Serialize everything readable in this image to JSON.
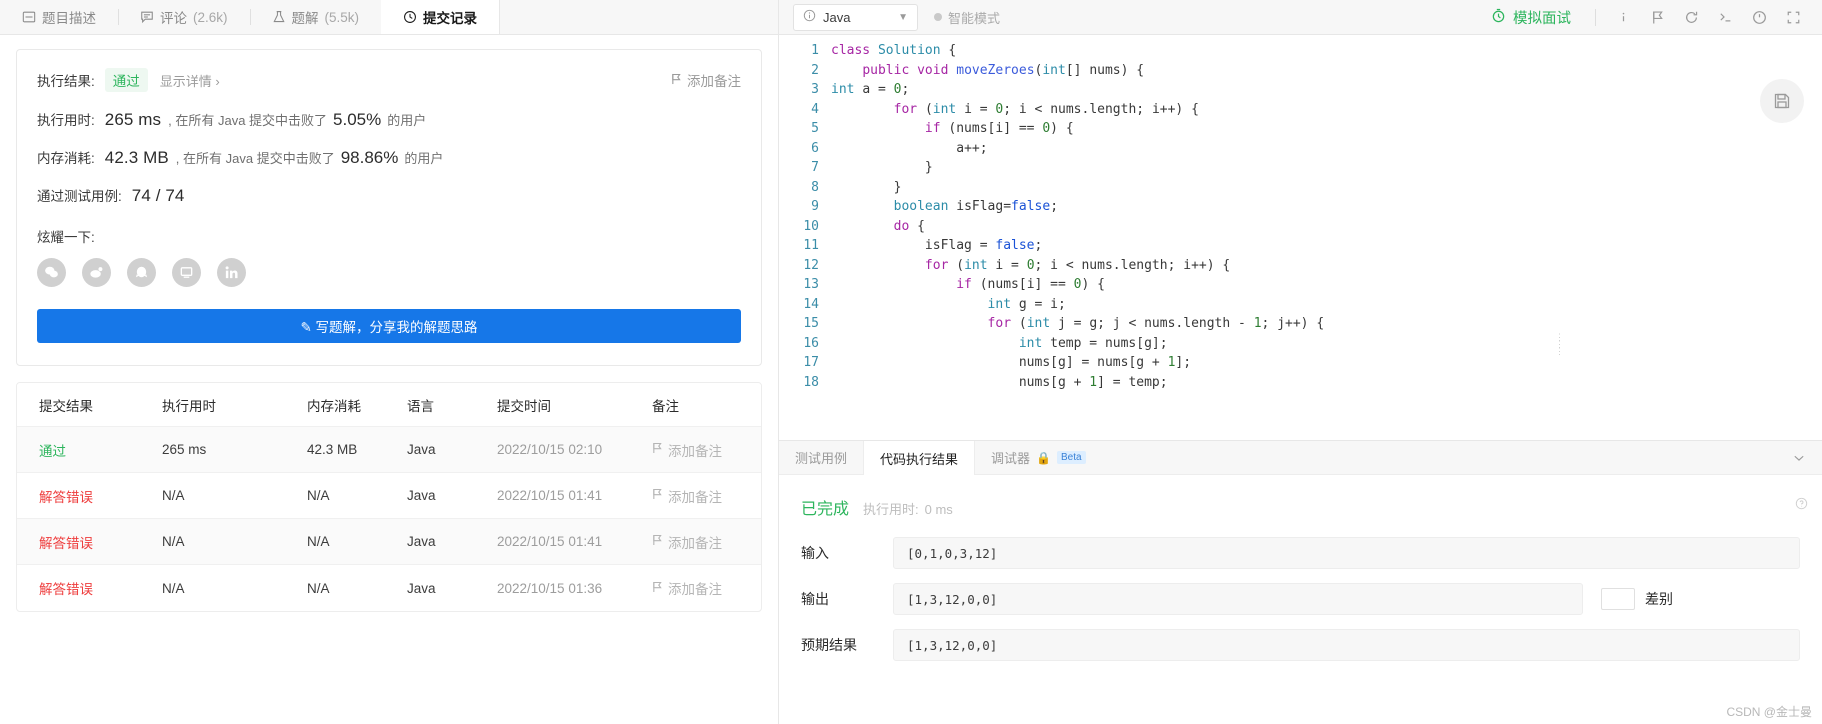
{
  "left_tabs": [
    {
      "label": "题目描述",
      "count": "",
      "icon": "description-icon",
      "active": false
    },
    {
      "label": "评论",
      "count": "(2.6k)",
      "icon": "comment-icon",
      "active": false
    },
    {
      "label": "题解",
      "count": "(5.5k)",
      "icon": "flask-icon",
      "active": false
    },
    {
      "label": "提交记录",
      "count": "",
      "icon": "clock-icon",
      "active": true
    }
  ],
  "result": {
    "exec_result_label": "执行结果:",
    "status": "通过",
    "detail_link": "显示详情 ›",
    "add_note": "添加备注",
    "runtime_label": "执行用时:",
    "runtime_value": "265 ms",
    "runtime_mid": ", 在所有 Java 提交中击败了",
    "runtime_pct": "5.05%",
    "runtime_suffix": "的用户",
    "memory_label": "内存消耗:",
    "memory_value": "42.3 MB",
    "memory_mid": ", 在所有 Java 提交中击败了",
    "memory_pct": "98.86%",
    "memory_suffix": "的用户",
    "testcase_label": "通过测试用例:",
    "testcase_value": "74 / 74",
    "share_label": "炫耀一下:",
    "socials": [
      "wechat-icon",
      "weibo-icon",
      "qq-icon",
      "douban-icon",
      "linkedin-icon"
    ],
    "write_button": "✎ 写题解，分享我的解题思路"
  },
  "table": {
    "headers": [
      "提交结果",
      "执行用时",
      "内存消耗",
      "语言",
      "提交时间",
      "备注"
    ],
    "note_label": "添加备注",
    "rows": [
      {
        "status": "通过",
        "status_type": "pass",
        "runtime": "265 ms",
        "memory": "42.3 MB",
        "lang": "Java",
        "time": "2022/10/15 02:10"
      },
      {
        "status": "解答错误",
        "status_type": "fail",
        "runtime": "N/A",
        "memory": "N/A",
        "lang": "Java",
        "time": "2022/10/15 01:41"
      },
      {
        "status": "解答错误",
        "status_type": "fail",
        "runtime": "N/A",
        "memory": "N/A",
        "lang": "Java",
        "time": "2022/10/15 01:41"
      },
      {
        "status": "解答错误",
        "status_type": "fail",
        "runtime": "N/A",
        "memory": "N/A",
        "lang": "Java",
        "time": "2022/10/15 01:36"
      }
    ]
  },
  "toolbar": {
    "language": "Java",
    "smart_mode": "智能模式",
    "mock_interview": "模拟面试",
    "icons": [
      "info-icon",
      "run-icon",
      "reset-icon",
      "console-icon",
      "settings-icon",
      "fullscreen-icon"
    ]
  },
  "code": {
    "lines": [
      {
        "no": "1",
        "text": "class Solution {"
      },
      {
        "no": "2",
        "text": "    public void moveZeroes(int[] nums) {"
      },
      {
        "no": "3",
        "text": "int a = 0;"
      },
      {
        "no": "4",
        "text": "        for (int i = 0; i < nums.length; i++) {"
      },
      {
        "no": "5",
        "text": "            if (nums[i] == 0) {"
      },
      {
        "no": "6",
        "text": "                a++;"
      },
      {
        "no": "7",
        "text": "            }"
      },
      {
        "no": "8",
        "text": "        }"
      },
      {
        "no": "9",
        "text": "        boolean isFlag=false;"
      },
      {
        "no": "10",
        "text": "        do {"
      },
      {
        "no": "11",
        "text": "            isFlag = false;"
      },
      {
        "no": "12",
        "text": "            for (int i = 0; i < nums.length; i++) {"
      },
      {
        "no": "13",
        "text": "                if (nums[i] == 0) {"
      },
      {
        "no": "14",
        "text": "                    int g = i;"
      },
      {
        "no": "15",
        "text": "                    for (int j = g; j < nums.length - 1; j++) {"
      },
      {
        "no": "16",
        "text": "                        int temp = nums[g];"
      },
      {
        "no": "17",
        "text": "                        nums[g] = nums[g + 1];"
      },
      {
        "no": "18",
        "text": "                        nums[g + 1] = temp;"
      }
    ]
  },
  "console": {
    "tabs": [
      {
        "label": "测试用例",
        "active": false,
        "beta": false
      },
      {
        "label": "代码执行结果",
        "active": true,
        "beta": false
      },
      {
        "label": "调试器",
        "active": false,
        "beta": true,
        "beta_label": "Beta"
      }
    ],
    "status": "已完成",
    "elapsed_label": "执行用时:",
    "elapsed_value": "0 ms",
    "input_label": "输入",
    "input_value": "[0,1,0,3,12]",
    "output_label": "输出",
    "output_value": "[1,3,12,0,0]",
    "expected_label": "预期结果",
    "expected_value": "[1,3,12,0,0]",
    "diff_label": "差别"
  },
  "watermark": "CSDN @金士曼",
  "colors": {
    "accent_blue": "#1677e8",
    "pass_green": "#2db55d",
    "fail_red": "#ee3d3d"
  }
}
